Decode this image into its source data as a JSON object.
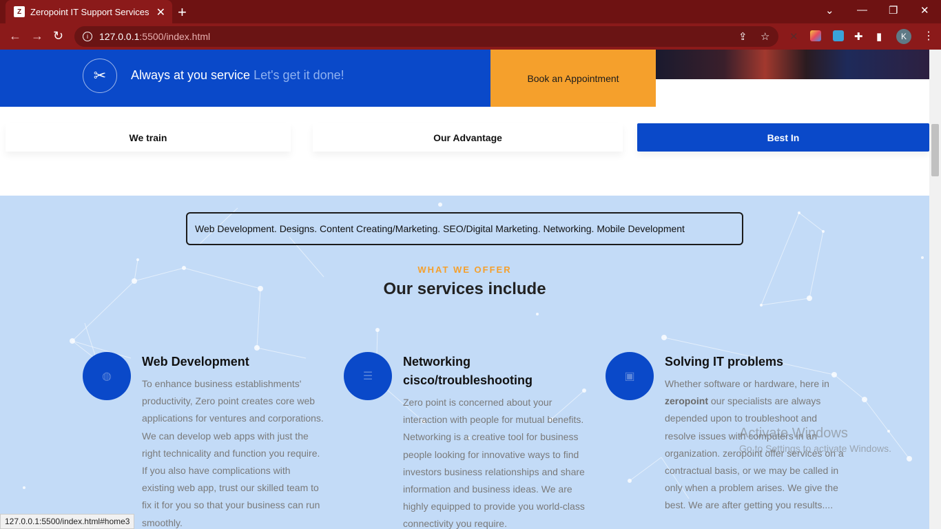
{
  "browser": {
    "tab_title": "Zeropoint IT Support Services",
    "url_host": "127.0.0.1",
    "url_rest": ":5500/index.html",
    "avatar_letter": "K",
    "status_url": "127.0.0.1:5500/index.html#home3"
  },
  "banner": {
    "text": "Always at you service",
    "accent": "Let's get it done!",
    "appointment_label": "Book an Appointment"
  },
  "feature_tabs": [
    {
      "label": "We train"
    },
    {
      "label": "Our Advantage"
    },
    {
      "label": "Best In",
      "active": true
    }
  ],
  "services": {
    "ticker": "Web Development. Designs. Content Creating/Marketing. SEO/Digital Marketing. Networking. Mobile Development",
    "eyebrow": "WHAT WE OFFER",
    "heading": "Our services include",
    "cards": [
      {
        "icon": "globe-icon",
        "title": "Web Development",
        "lines": [
          "To enhance business establishments'",
          "productivity, Zero point creates core web",
          "applications for ventures and corporations.",
          "We can develop web apps with just the",
          "right technicality and function you require.",
          "If you also have complications with",
          "existing web app, trust our skilled team to",
          "fix it for you so that your business can run",
          "smoothly."
        ]
      },
      {
        "icon": "server-icon",
        "title_line1": "Networking",
        "title_line2": "cisco/troubleshooting",
        "lines": [
          "Zero point is concerned about your",
          "interaction with people for mutual benefits.",
          "Networking is a creative tool for business",
          "people looking for innovative ways to find",
          "investors business relationships and share",
          "information and business ideas. We are",
          "highly equipped to provide you world-class",
          "connectivity you require."
        ]
      },
      {
        "icon": "chip-icon",
        "title": "Solving IT problems",
        "line1": "Whether software or hardware, here in",
        "bold": "zeropoint",
        "line2_rest": " our specialists are always",
        "lines": [
          "depended upon to troubleshoot and",
          "resolve issues with computers in an",
          "organization. zeropoint offer services on a",
          "contractual basis, or we may be called in",
          "only when a problem arises. We give the",
          "best. We are after getting you results...."
        ]
      }
    ]
  },
  "watermark": {
    "line1": "Activate Windows",
    "line2": "Go to Settings to activate Windows."
  },
  "colors": {
    "browser_frame": "#8b1a1a",
    "brand_blue": "#0a49c9",
    "accent_orange": "#f5a02c",
    "services_bg": "#c3dbf7"
  }
}
